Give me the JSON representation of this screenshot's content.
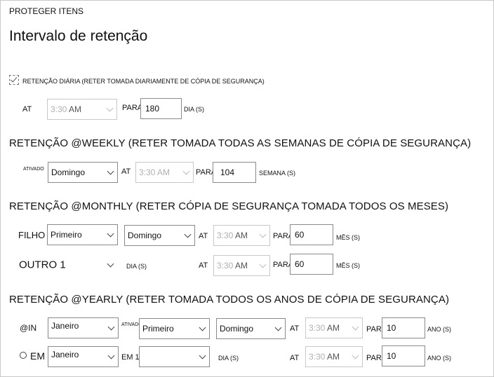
{
  "header": {
    "section": "PROTEGER ITENS",
    "title": "Intervalo de retenção"
  },
  "daily": {
    "checkbox_label": "RETENÇÃO DIÁRIA (RETER TOMADA DIARIAMENTE DE CÓPIA DE SEGURANÇA)",
    "checked": true,
    "at_label": "AT",
    "time": "3:30",
    "ampm": "AM",
    "for_label": "PARA",
    "count": "180",
    "unit": "DIA (S)"
  },
  "weekly": {
    "heading": "RETENÇÃO @WEEKLY (RETER TOMADA TODAS AS SEMANAS DE CÓPIA DE SEGURANÇA)",
    "on_label": "ATIVADO",
    "day": "Domingo",
    "at_label": "AT",
    "time": "3:30",
    "ampm": "AM",
    "for_label": "PARA",
    "count": "104",
    "unit": "SEMANA (S)"
  },
  "monthly": {
    "heading": "RETENÇÃO @MONTHLY (RETER CÓPIA DE SEGURANÇA TOMADA TODOS OS MESES)",
    "row1": {
      "label": "FILHO",
      "week": "Primeiro",
      "day": "Domingo",
      "at_label": "AT",
      "time": "3:30",
      "ampm": "AM",
      "for_label": "PARA",
      "count": "60",
      "unit": "MÊS (S)"
    },
    "row2": {
      "day_select": "OUTRO 1",
      "day_unit": "DIA (S)",
      "at_label": "AT",
      "time": "3:30",
      "ampm": "AM",
      "for_label": "PARA",
      "count": "60",
      "unit": "MÊS (S)"
    }
  },
  "yearly": {
    "heading": "RETENÇÃO @YEARLY (RETER TOMADA TODOS OS ANOS DE CÓPIA DE SEGURANÇA)",
    "row1": {
      "label": "@IN",
      "month": "Janeiro",
      "on_label": "ATIVADO",
      "week": "Primeiro",
      "day": "Domingo",
      "at_label": "AT",
      "time": "3:30",
      "ampm": "AM",
      "for_label": "PARA",
      "count": "10",
      "unit": "ANO (S)"
    },
    "row2": {
      "label": "EM",
      "month": "Janeiro",
      "em_label": "EM 1",
      "day": "",
      "day_unit": "DIA (S)",
      "at_label": "AT",
      "time": "3:30",
      "ampm": "AM",
      "for_label": "PARA",
      "count": "10",
      "unit": "ANO (S)"
    }
  }
}
